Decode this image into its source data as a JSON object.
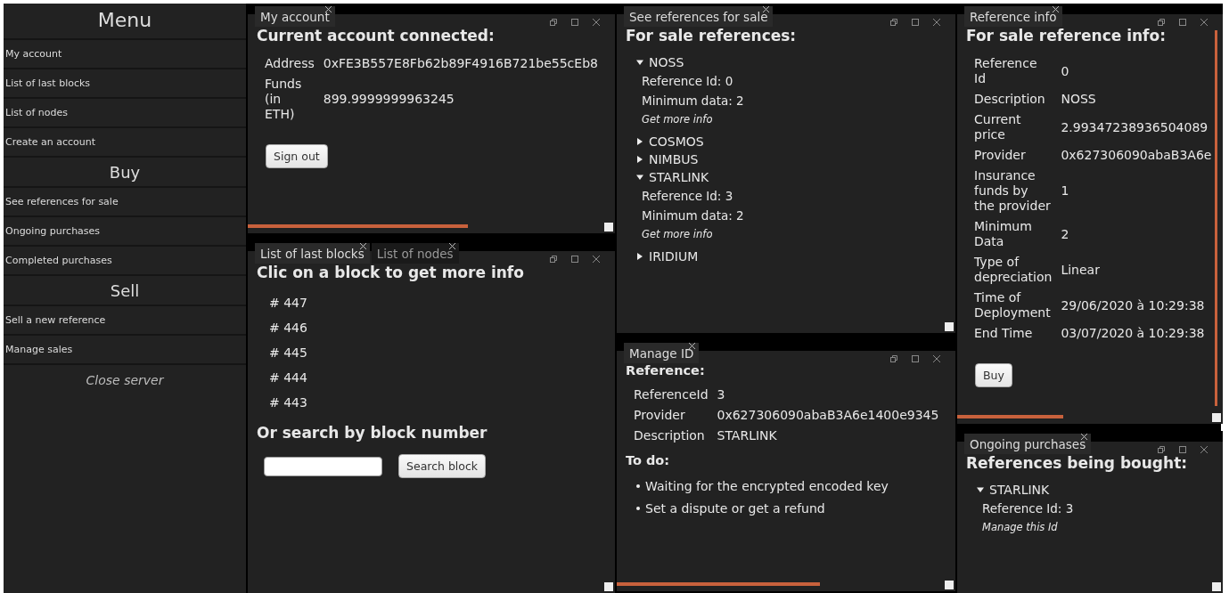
{
  "sidebar": {
    "title": "Menu",
    "items": [
      {
        "kind": "link",
        "label": "My account"
      },
      {
        "kind": "link",
        "label": "List of last blocks"
      },
      {
        "kind": "link",
        "label": "List of nodes"
      },
      {
        "kind": "link",
        "label": "Create an account"
      },
      {
        "kind": "heading",
        "label": "Buy"
      },
      {
        "kind": "link",
        "label": "See references for sale"
      },
      {
        "kind": "link",
        "label": "Ongoing purchases"
      },
      {
        "kind": "link",
        "label": "Completed purchases"
      },
      {
        "kind": "heading",
        "label": "Sell"
      },
      {
        "kind": "link",
        "label": "Sell a new reference"
      },
      {
        "kind": "link",
        "label": "Manage sales"
      },
      {
        "kind": "action",
        "label": "Close server"
      }
    ]
  },
  "columns": [
    [
      {
        "tabs": [
          {
            "label": "My account",
            "selected": true
          }
        ],
        "scroll_horizontal": true,
        "scroll_vertical": false,
        "content": [
          {
            "kind": "heading",
            "text": "Current account connected:"
          },
          {
            "kind": "fields",
            "rows": [
              {
                "label": "Address",
                "value": "0xFE3B557E8Fb62b89F4916B721be55cEb8"
              },
              {
                "label": "Funds (in ETH)",
                "value": "899.9999999963245"
              }
            ]
          },
          {
            "kind": "button",
            "label": "Sign out"
          }
        ]
      },
      {
        "tabs": [
          {
            "label": "List of last blocks",
            "selected": true
          },
          {
            "label": "List of nodes",
            "selected": false
          }
        ],
        "scroll_horizontal": false,
        "scroll_vertical": false,
        "content": [
          {
            "kind": "heading",
            "text": "Clic on a block to get more info"
          },
          {
            "kind": "links",
            "items": [
              "# 447",
              "# 446",
              "# 445",
              "# 444",
              "# 443"
            ]
          },
          {
            "kind": "heading",
            "text": "Or search by block number"
          },
          {
            "kind": "search",
            "button": "Search block"
          }
        ]
      }
    ],
    [
      {
        "tabs": [
          {
            "label": "See references for sale",
            "selected": true
          }
        ],
        "scroll_horizontal": false,
        "scroll_vertical": false,
        "content": [
          {
            "kind": "heading",
            "text": "For sale references:"
          },
          {
            "kind": "tree",
            "items": [
              {
                "label": "NOSS",
                "expanded": true,
                "details": [
                  "Reference Id: 0",
                  "Minimum data: 2"
                ],
                "link": "Get more info"
              },
              {
                "label": "COSMOS",
                "expanded": false
              },
              {
                "label": "NIMBUS",
                "expanded": false
              },
              {
                "label": "STARLINK",
                "expanded": true,
                "details": [
                  "Reference Id: 3",
                  "Minimum data: 2"
                ],
                "link": "Get more info"
              },
              {
                "label": "IRIDIUM",
                "expanded": false
              }
            ]
          }
        ]
      },
      {
        "tabs": [
          {
            "label": "Manage ID",
            "selected": true
          }
        ],
        "scroll_horizontal": true,
        "scroll_vertical": false,
        "content": [
          {
            "kind": "subheading",
            "text": "Reference:"
          },
          {
            "kind": "fields",
            "rows": [
              {
                "label": "ReferenceId",
                "value": "3"
              },
              {
                "label": "Provider",
                "value": "0x627306090abaB3A6e1400e9345"
              },
              {
                "label": "Description",
                "value": "STARLINK"
              }
            ]
          },
          {
            "kind": "subheading",
            "text": "To do:"
          },
          {
            "kind": "bullets",
            "items": [
              "Waiting for the encrypted encoded key",
              "Set a dispute or get a refund"
            ]
          }
        ]
      }
    ],
    [
      {
        "tabs": [
          {
            "label": "Reference info",
            "selected": true
          }
        ],
        "scroll_horizontal": true,
        "scroll_vertical": true,
        "content": [
          {
            "kind": "heading",
            "text": "For sale reference info:"
          },
          {
            "kind": "fields",
            "rows": [
              {
                "label": "Reference Id",
                "value": "0"
              },
              {
                "label": "Description",
                "value": "NOSS"
              },
              {
                "label": "Current price",
                "value": "2.99347238936504089"
              },
              {
                "label": "Provider",
                "value": "0x627306090abaB3A6e"
              },
              {
                "label": "Insurance funds by the provider",
                "value": "1"
              },
              {
                "label": "Minimum Data",
                "value": "2"
              },
              {
                "label": "Type of depreciation",
                "value": "Linear"
              },
              {
                "label": "Time of Deployment",
                "value": "29/06/2020 à 10:29:38"
              },
              {
                "label": "End Time",
                "value": "03/07/2020 à 10:29:38"
              }
            ]
          },
          {
            "kind": "button",
            "label": "Buy"
          }
        ]
      },
      {
        "tabs": [
          {
            "label": "Ongoing purchases",
            "selected": true
          }
        ],
        "scroll_horizontal": false,
        "scroll_vertical": false,
        "content": [
          {
            "kind": "heading",
            "text": "References being bought:"
          },
          {
            "kind": "tree",
            "items": [
              {
                "label": "STARLINK",
                "expanded": true,
                "details": [
                  "Reference Id: 3"
                ],
                "link": "Manage this Id"
              }
            ]
          }
        ]
      }
    ]
  ]
}
